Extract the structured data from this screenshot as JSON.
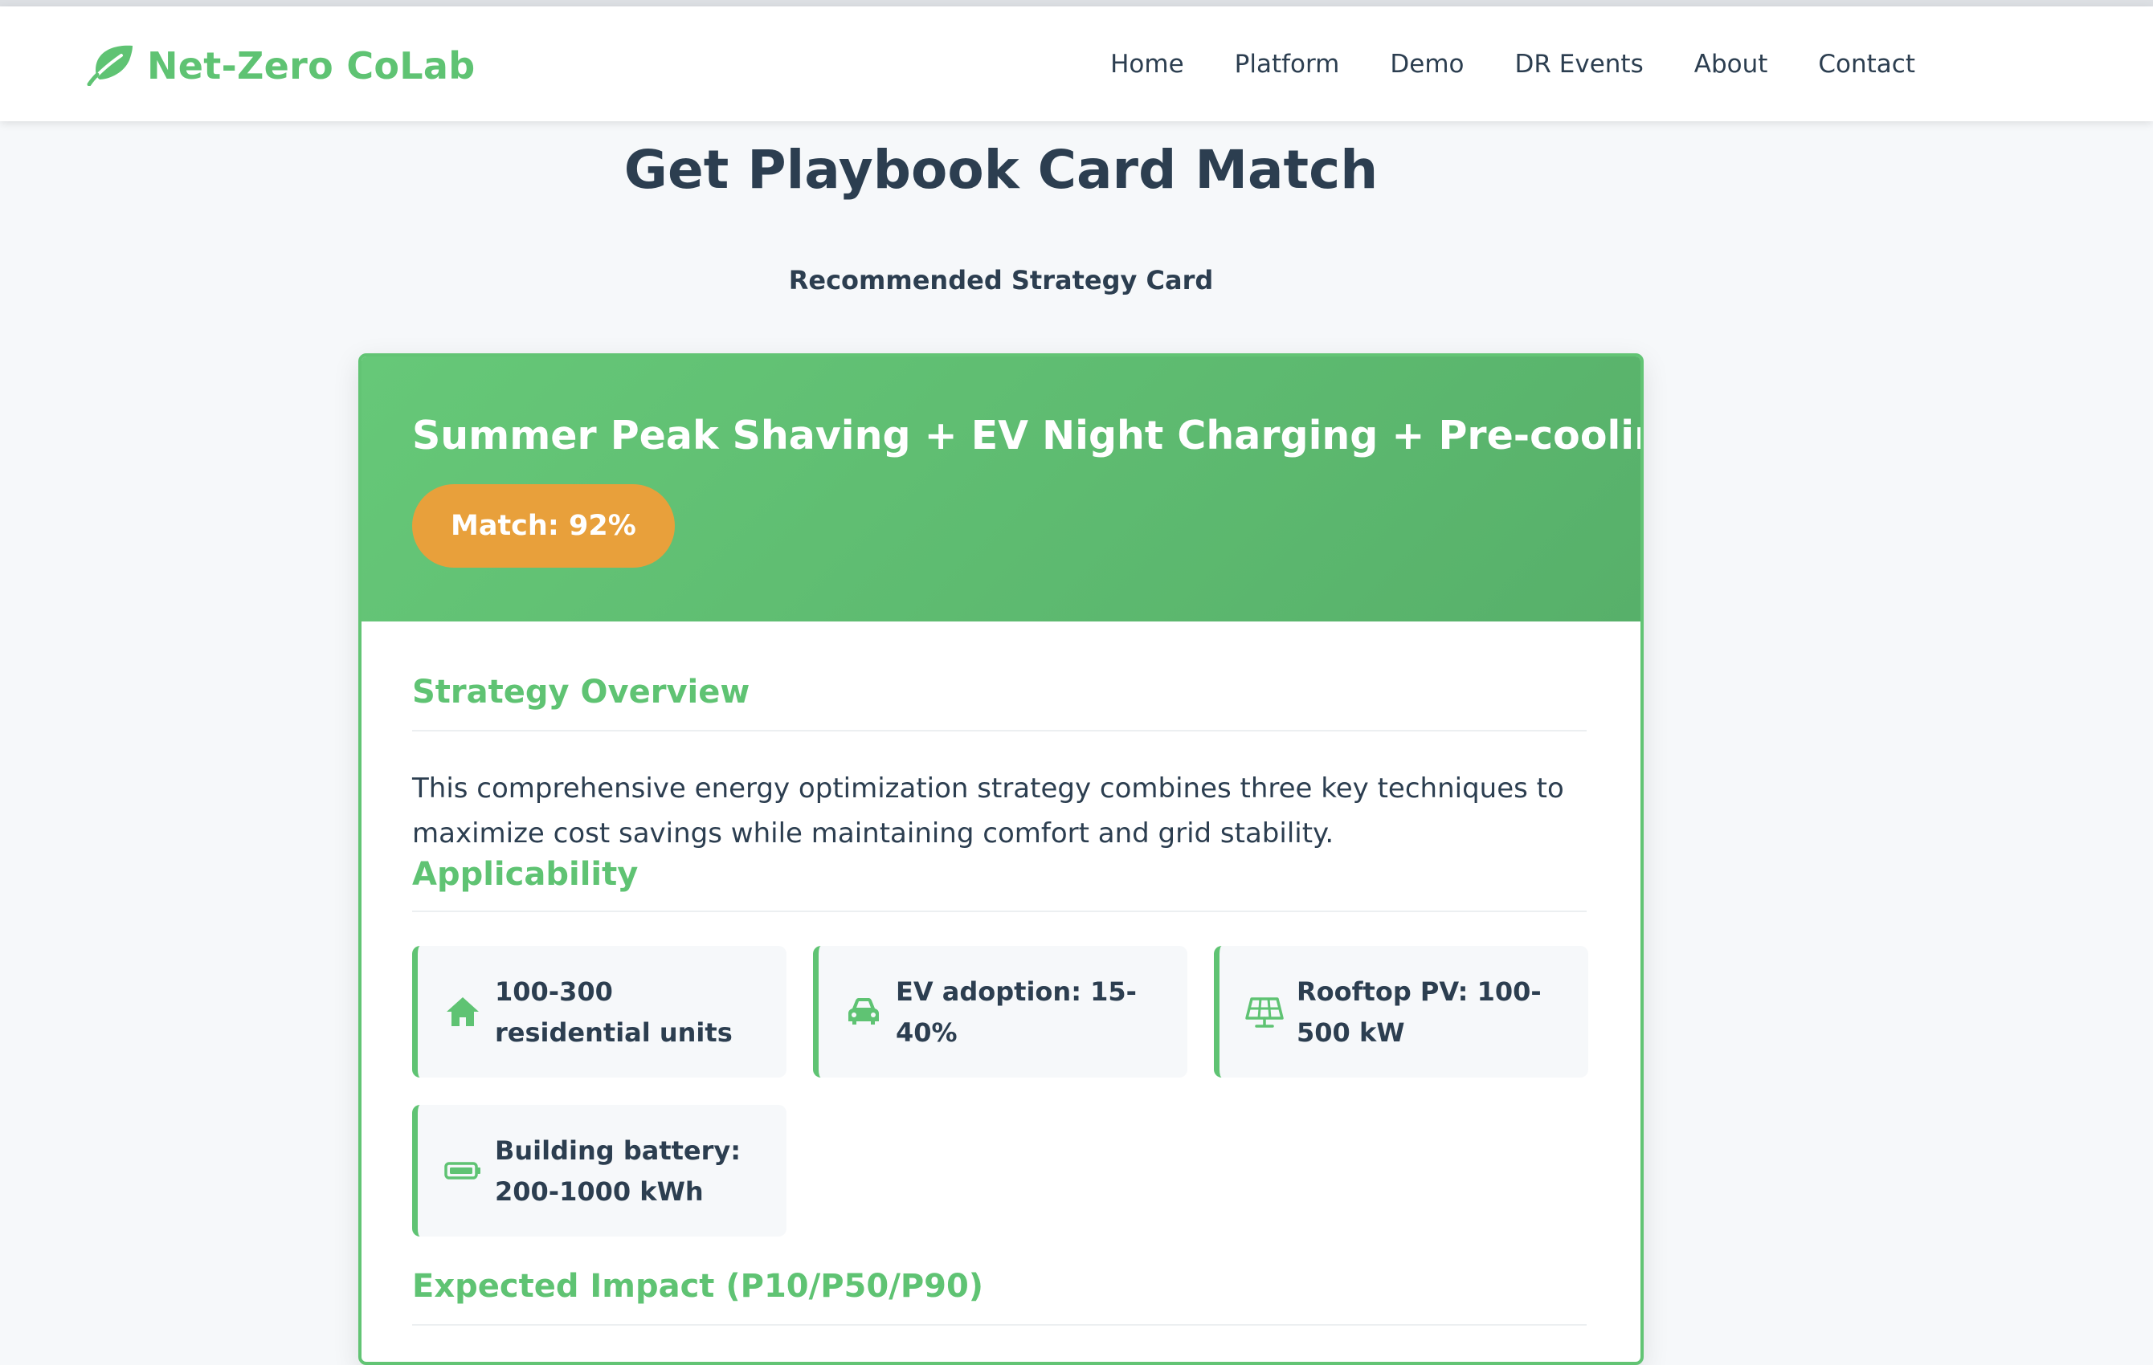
{
  "brand": {
    "name": "Net-Zero CoLab",
    "icon": "leaf-icon"
  },
  "nav": {
    "links": [
      "Home",
      "Platform",
      "Demo",
      "DR Events",
      "About",
      "Contact"
    ]
  },
  "page": {
    "title": "Get Playbook Card Match",
    "subtitle": "Recommended Strategy Card"
  },
  "card": {
    "title": "Summer Peak Shaving + EV Night Charging + Pre-cooling",
    "match": "Match: 92%",
    "overview_heading": "Strategy Overview",
    "overview_text": "This comprehensive energy optimization strategy combines three key techniques to maximize cost savings while maintaining comfort and grid stability.",
    "applicability_heading": "Applicability",
    "applicability": [
      {
        "icon": "home-icon",
        "text": "100-300 residential units"
      },
      {
        "icon": "car-icon",
        "text": "EV adoption: 15-40%"
      },
      {
        "icon": "solar-panel-icon",
        "text": "Rooftop PV: 100-500 kW"
      },
      {
        "icon": "battery-icon",
        "text": "Building battery: 200-1000 kWh"
      }
    ],
    "impact_heading": "Expected Impact (P10/P50/P90)"
  },
  "colors": {
    "accent": "#5fc373",
    "header_gradient_start": "#66c878",
    "header_gradient_end": "#57b06a",
    "badge": "#e8a03b",
    "text": "#2c3e50",
    "page_bg": "#f6f8fa"
  }
}
